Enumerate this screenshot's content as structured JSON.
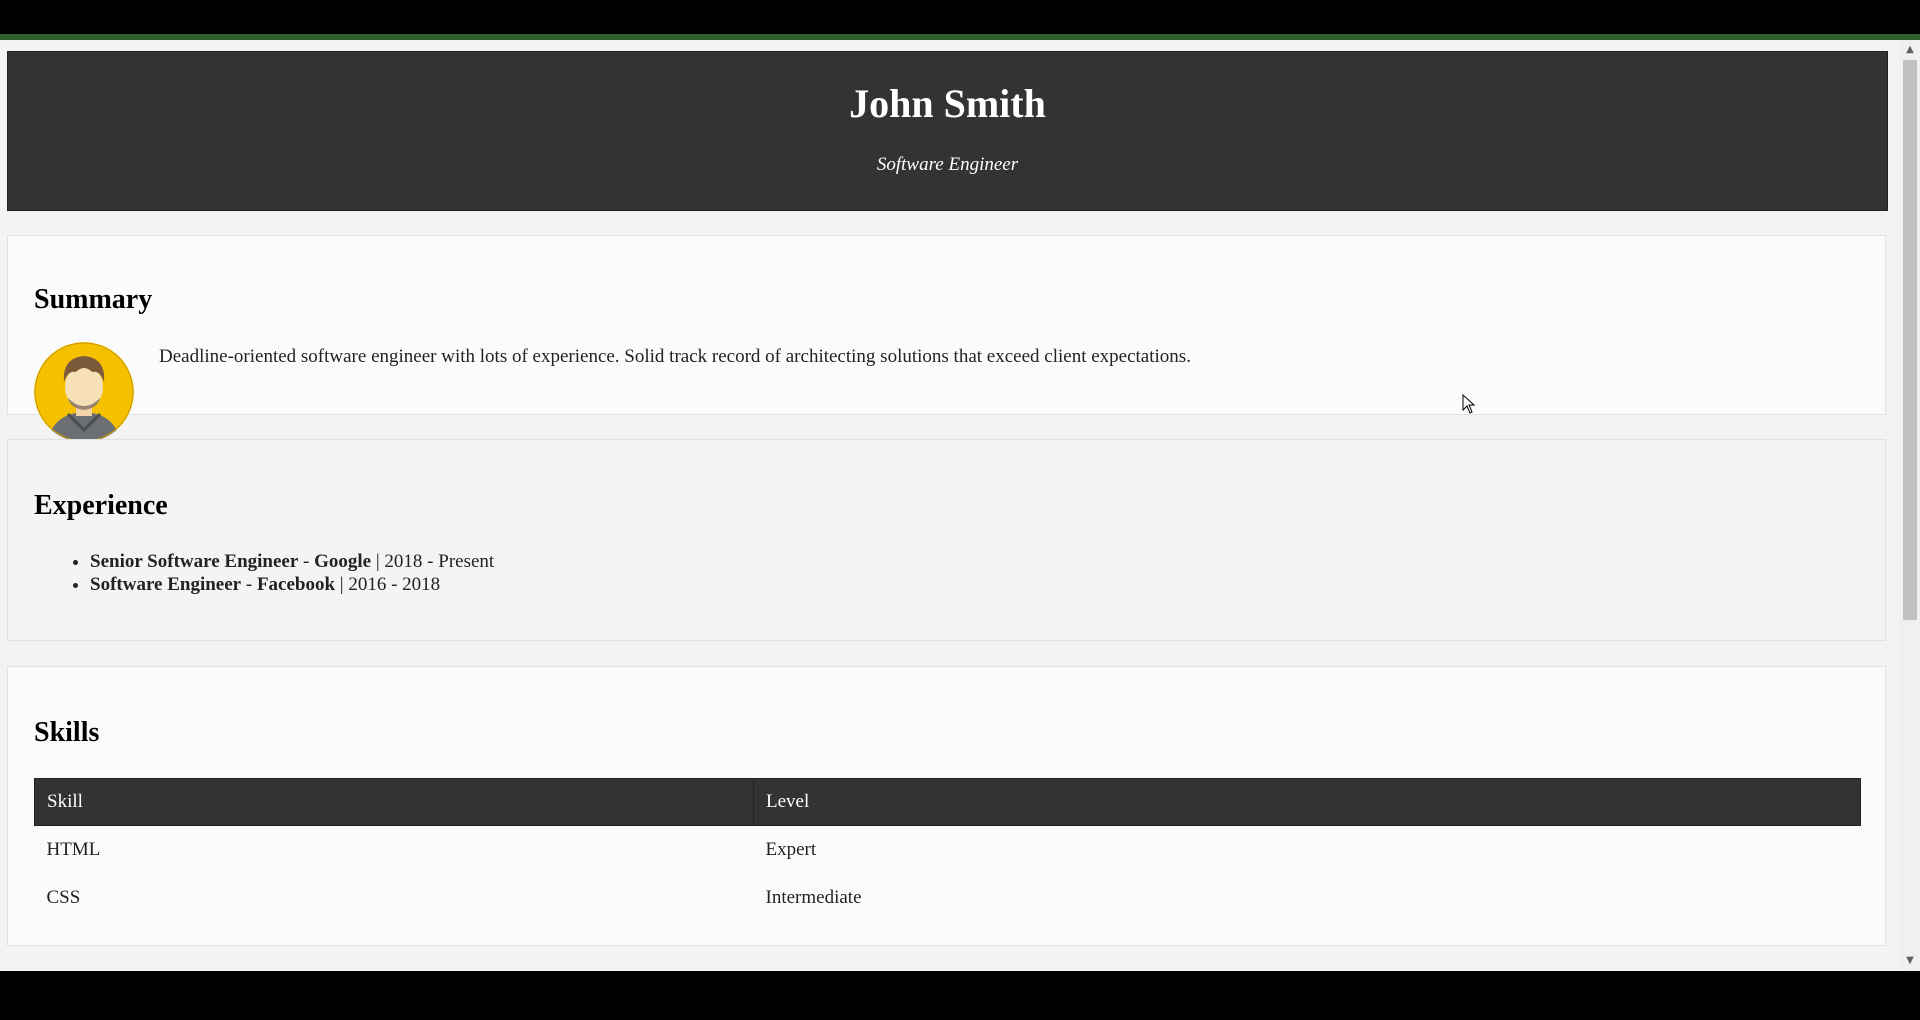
{
  "header": {
    "name": "John Smith",
    "title": "Software Engineer"
  },
  "summary": {
    "heading": "Summary",
    "text": "Deadline-oriented software engineer with lots of experience. Solid track record of architecting solutions that exceed client expectations.",
    "avatar_icon": "person-avatar-icon"
  },
  "experience": {
    "heading": "Experience",
    "items": [
      {
        "role": "Senior Software Engineer",
        "sep": " - ",
        "company": "Google",
        "period": " | 2018 - Present"
      },
      {
        "role": "Software Engineer",
        "sep": " - ",
        "company": "Facebook",
        "period": " | 2016 - 2018"
      }
    ]
  },
  "skills": {
    "heading": "Skills",
    "columns": [
      "Skill",
      "Level"
    ],
    "rows": [
      [
        "HTML",
        "Expert"
      ],
      [
        "CSS",
        "Intermediate"
      ]
    ]
  },
  "colors": {
    "header_bg": "#333333",
    "accent_bar": "#2f5f2f",
    "avatar_bg": "#f5c000"
  },
  "icons": {
    "scroll_up": "▲",
    "scroll_down": "▼"
  }
}
